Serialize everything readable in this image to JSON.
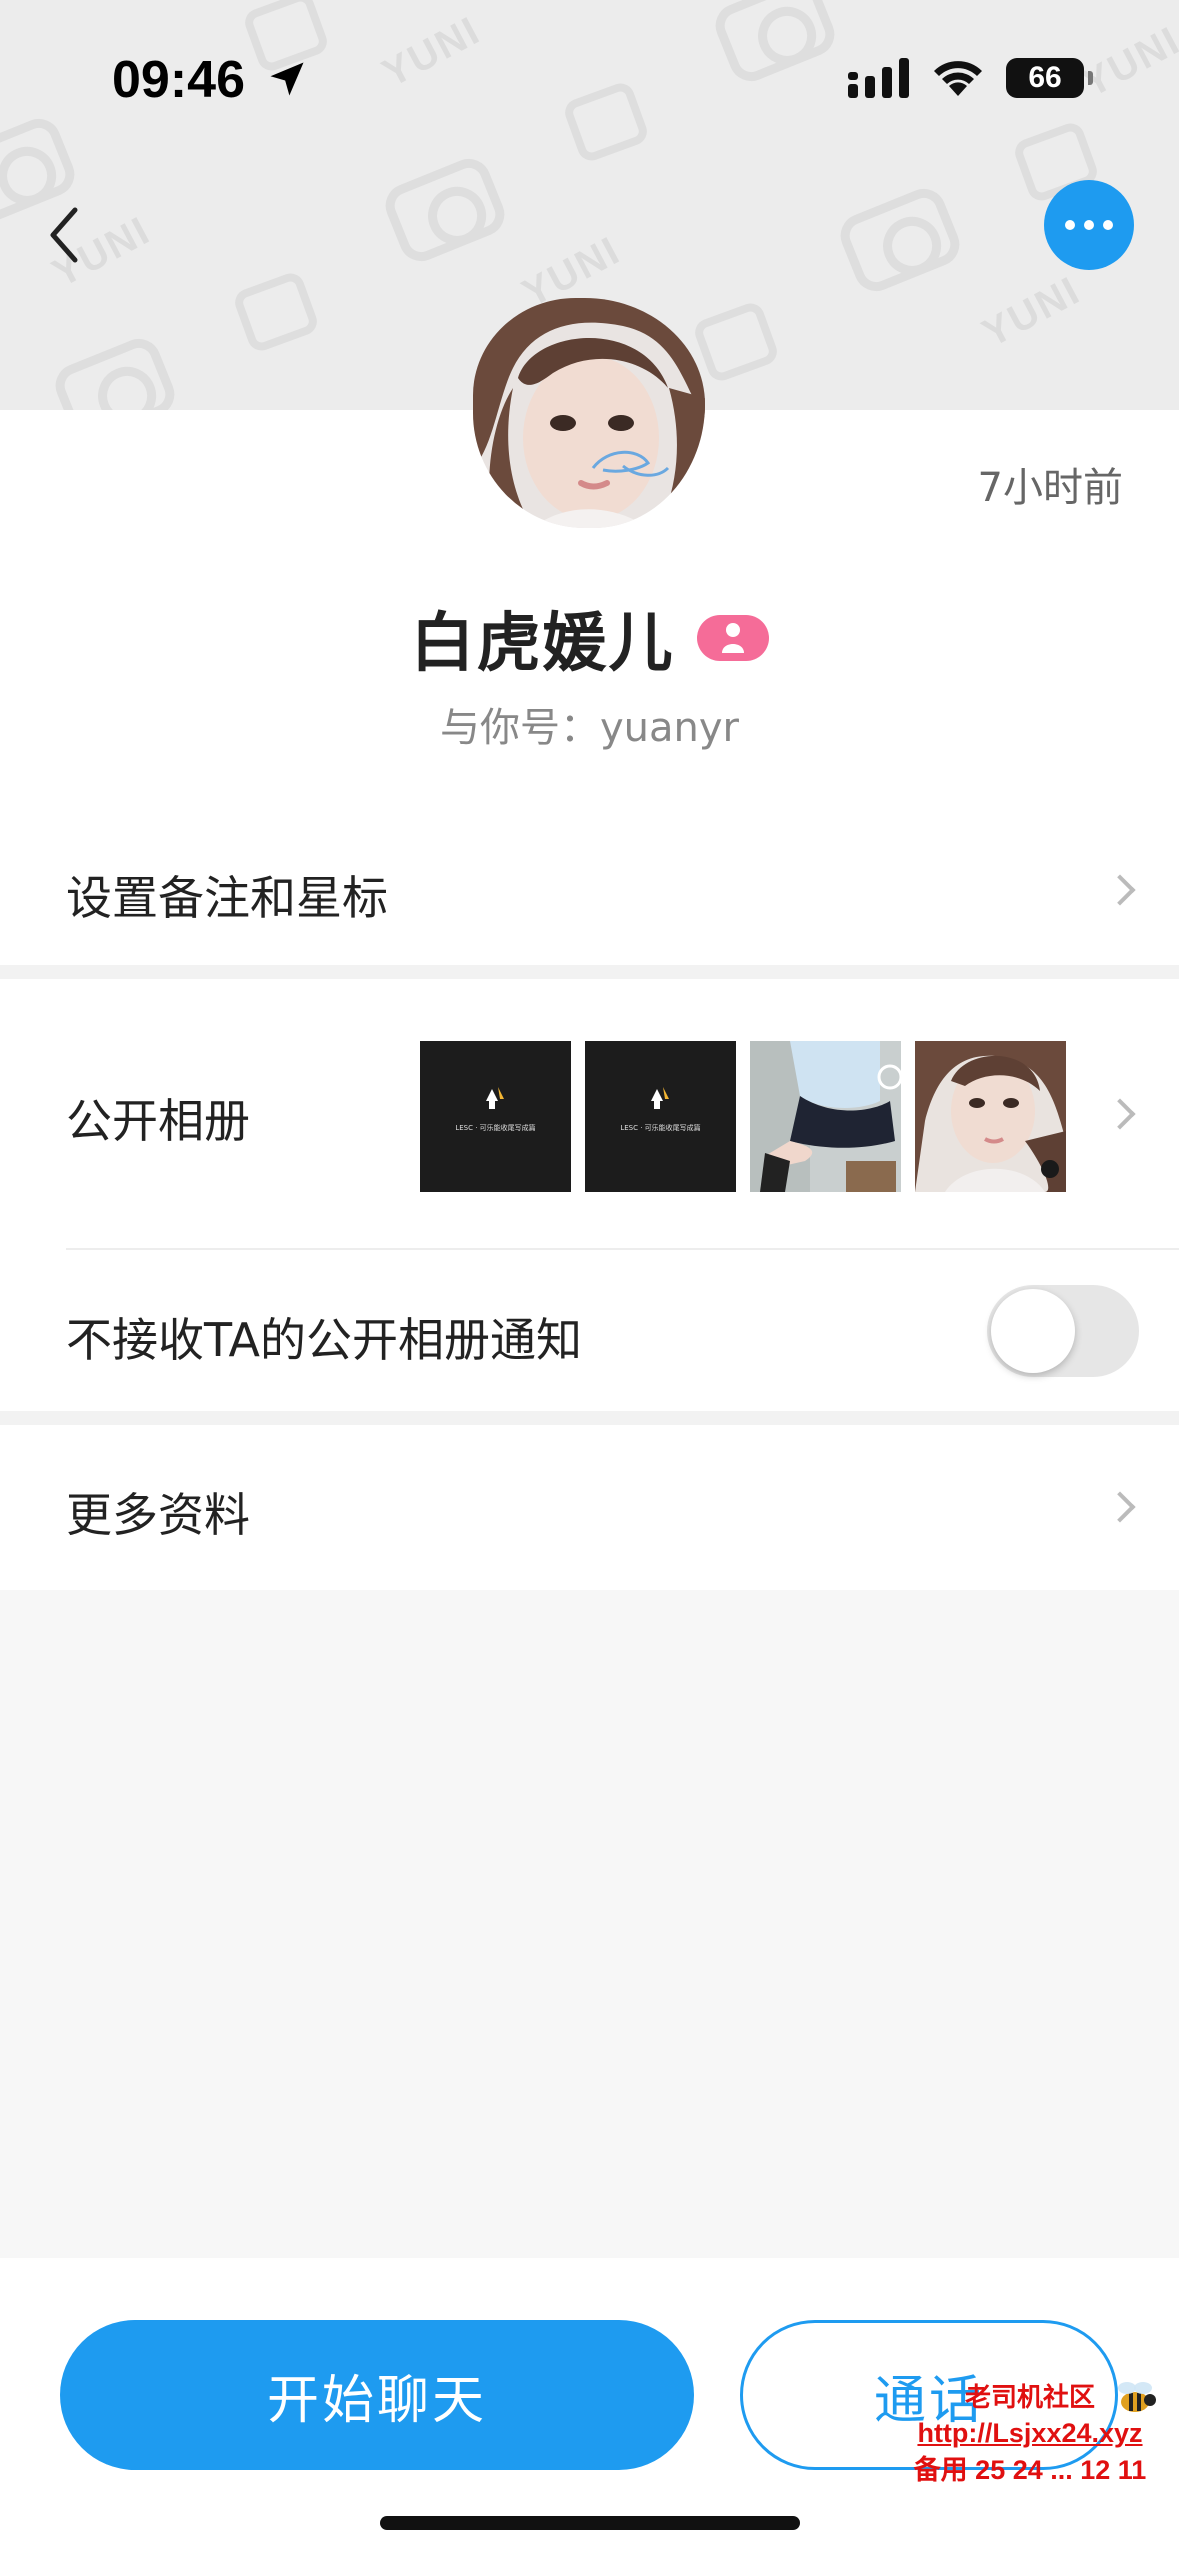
{
  "status_bar": {
    "time": "09:46",
    "battery": "66"
  },
  "banner": {
    "watermark": "YUNI"
  },
  "profile": {
    "last_seen": "7小时前",
    "name": "白虎媛儿",
    "handle": "与你号：yuanyr"
  },
  "rows": {
    "remark": "设置备注和星标",
    "album": "公开相册",
    "album_notify": "不接收TA的公开相册通知",
    "album_notify_on": false,
    "more_info": "更多资料"
  },
  "album_thumbs": [
    {
      "kind": "dark",
      "caption": "LESC · 可乐能收尾写成篇"
    },
    {
      "kind": "dark",
      "caption": "LESC · 可乐能收尾写成篇"
    },
    {
      "kind": "photo",
      "caption": ""
    },
    {
      "kind": "photo",
      "caption": ""
    }
  ],
  "actions": {
    "chat": "开始聊天",
    "call": "通话"
  },
  "overlay_ad": {
    "line1": "老司机社区",
    "line2": "http://Lsjxx24.xyz",
    "line3": "备用 25 24 ... 12 11"
  },
  "colors": {
    "accent": "#1e9bf0",
    "badge": "#f56c98",
    "ad": "#e01010"
  }
}
